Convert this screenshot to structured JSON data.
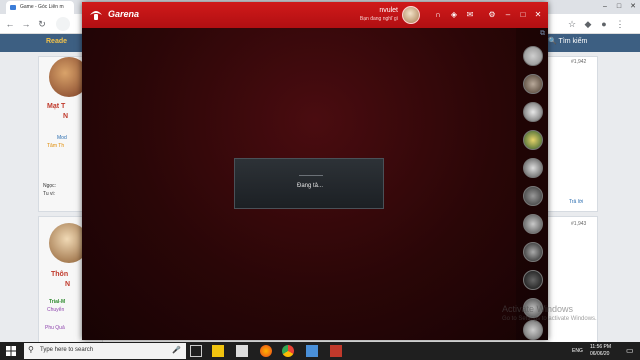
{
  "browser": {
    "tab_title": "Game - Góc Liên m",
    "colors": {
      "tabstrip": "#dee1e6"
    }
  },
  "forum": {
    "reader_label": "Reade",
    "search_label": "Tìm kiếm",
    "posts": [
      {
        "username": "Mạt T",
        "username_line2": "N",
        "post_number": "#1,942",
        "reply_label": "Trả lời"
      },
      {
        "username": "Thôn",
        "username_line2": "N",
        "post_number": "#1,943"
      }
    ],
    "side_text": [
      "Mod",
      "Tâm Th",
      "Ngọc:",
      "Tu vi:",
      "Trial-M",
      "Chuyển",
      "Phu Quả"
    ]
  },
  "garena": {
    "brand": "Garena",
    "username": "nvulet",
    "status": "Bạn đang nghĩ gì",
    "loading_text": "Đang tả...",
    "accent_color": "#d01a1a",
    "title_icons": [
      "headset-icon",
      "shield-icon",
      "mail-icon",
      "gear-icon",
      "minimize-icon",
      "maximize-icon",
      "close-icon"
    ],
    "friends_count": 11
  },
  "watermark": {
    "title": "Activate Windows",
    "subtitle": "Go to Settings to activate Windows."
  },
  "taskbar": {
    "search_placeholder": "Type here to search",
    "time": "11:56 PM",
    "date": "06/06/20",
    "language": "ENG"
  }
}
